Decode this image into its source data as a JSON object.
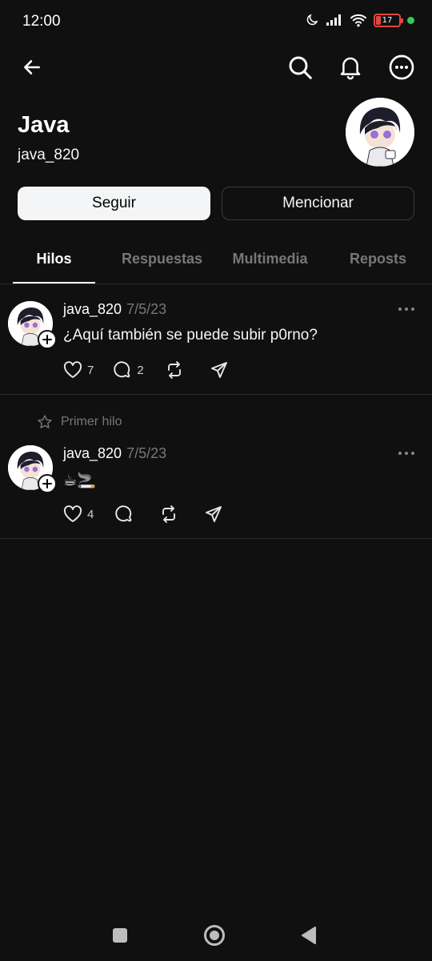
{
  "status_bar": {
    "time": "12:00",
    "battery": "17"
  },
  "profile": {
    "name": "Java",
    "handle": "java_820"
  },
  "buttons": {
    "follow": "Seguir",
    "mention": "Mencionar"
  },
  "tabs": [
    {
      "label": "Hilos",
      "active": true
    },
    {
      "label": "Respuestas",
      "active": false
    },
    {
      "label": "Multimedia",
      "active": false
    },
    {
      "label": "Reposts",
      "active": false
    }
  ],
  "posts": [
    {
      "username": "java_820",
      "date": "7/5/23",
      "text": "¿Aquí también se puede subir p0rno?",
      "likes": "7",
      "replies": "2"
    },
    {
      "pinned_label": "Primer hilo",
      "username": "java_820",
      "date": "7/5/23",
      "text": "☕🚬",
      "likes": "4",
      "replies": ""
    }
  ],
  "colors": {
    "background": "#101010",
    "text": "#f3f5f7",
    "muted": "#777777",
    "battery_low": "#e04545",
    "online": "#35c759"
  }
}
